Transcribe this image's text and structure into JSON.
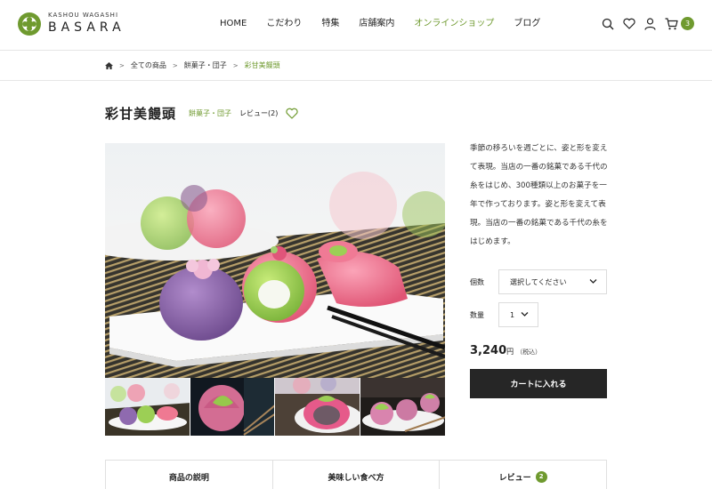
{
  "logo": {
    "sub": "KASHOU WAGASHI",
    "main": "BASARA"
  },
  "nav": [
    {
      "label": "HOME"
    },
    {
      "label": "こだわり"
    },
    {
      "label": "特集"
    },
    {
      "label": "店舗案内"
    },
    {
      "label": "オンラインショップ",
      "active": true
    },
    {
      "label": "ブログ"
    }
  ],
  "header_icons": [
    "search-icon",
    "heart-icon",
    "user-icon",
    "cart-icon"
  ],
  "cart_count": "3",
  "breadcrumb": {
    "items": [
      "全ての商品",
      "餅菓子・団子"
    ],
    "current": "彩甘美饅頭",
    "separator": ">"
  },
  "product": {
    "title": "彩甘美饅頭",
    "category": "餅菓子・団子",
    "review": "レビュー(2)",
    "description": "季節の移ろいを週ごとに、姿と形を変えて表現。当店の一番の銘菓である千代の糸をはじめ、300種類以上のお菓子を一年で作っております。姿と形を変えて表現。当店の一番の銘菓である千代の糸をはじめます。",
    "qty_label": "個数",
    "qty_placeholder": "選択してください",
    "amount_label": "数量",
    "amount_value": "1",
    "price_value": "3,240",
    "price_unit": "円",
    "price_tax": "（税込）",
    "cart_button": "カートに入れる"
  },
  "tabs": [
    {
      "label": "商品の説明"
    },
    {
      "label": "美味しい食べ方"
    },
    {
      "label": "レビュー",
      "badge": "2"
    }
  ],
  "colors": {
    "accent": "#6f9a2f",
    "button": "#262626"
  }
}
